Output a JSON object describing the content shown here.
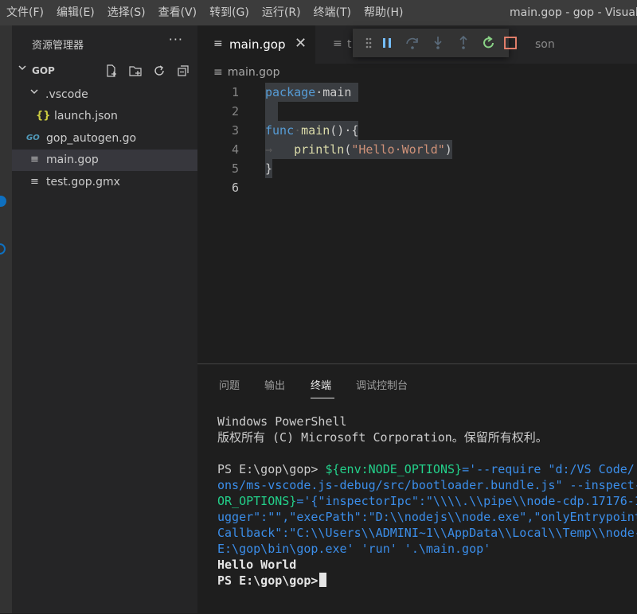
{
  "menu": [
    "文件(F)",
    "编辑(E)",
    "选择(S)",
    "查看(V)",
    "转到(G)",
    "运行(R)",
    "终端(T)",
    "帮助(H)"
  ],
  "window_title": "main.gop - gop - Visual",
  "sidebar": {
    "header": "资源管理器",
    "more": "···",
    "folder": "GOP",
    "items": [
      {
        "label": ".vscode",
        "icon": "chevron-down-icon",
        "glyph": "⌄"
      },
      {
        "label": "launch.json",
        "icon": "json-icon",
        "glyph": "{}"
      },
      {
        "label": "gop_autogen.go",
        "icon": "go-file-icon",
        "glyph": "GO"
      },
      {
        "label": "main.gop",
        "icon": "file-lines-icon",
        "glyph": "≡"
      },
      {
        "label": "test.gop.gmx",
        "icon": "file-lines-icon",
        "glyph": "≡"
      }
    ]
  },
  "tabs": {
    "active": "main.gop",
    "second": "t",
    "third_tail": "son"
  },
  "breadcrumb": "main.gop",
  "code": {
    "line_numbers": [
      "1",
      "2",
      "3",
      "4",
      "5",
      "6"
    ],
    "l1_kw": "package",
    "l1_rest": "·main",
    "l3_kw": "func",
    "l3_fn": "main",
    "l3_rest": "()·{",
    "l4_indent": "→   ",
    "l4_fn": "println",
    "l4_open": "(",
    "l4_str": "\"Hello·World\"",
    "l4_close": ")",
    "l5": "}"
  },
  "panel": {
    "tabs": [
      "问题",
      "输出",
      "终端",
      "调试控制台"
    ],
    "active_tab": "终端"
  },
  "terminal": {
    "l1": "Windows PowerShell",
    "l2": "版权所有 (C) Microsoft Corporation。保留所有权利。",
    "l3_prompt": "PS E:\\gop\\gop> ",
    "l3_var": "${env:NODE_OPTIONS}",
    "l3_rest": "='--require \"d:/VS Code/",
    "l4": "ons/ms-vscode.js-debug/src/bootloader.bundle.js\" --inspect-",
    "l5_a": "OR_OPTIONS}",
    "l5_b": "='{\"inspectorIpc\":\"\\\\\\\\.\\\\pipe\\\\node-cdp.17176-1",
    "l6": "ugger\":\"\",\"execPath\":\"D:\\\\nodejs\\\\node.exe\",\"onlyEntrypoint",
    "l7": "Callback\":\"C:\\\\Users\\\\ADMINI~1\\\\AppData\\\\Local\\\\Temp\\\\node-",
    "l8": "E:\\gop\\bin\\gop.exe' 'run' '.\\main.gop'",
    "l9": "Hello World",
    "l10": "PS E:\\gop\\gop>"
  },
  "colors": {
    "accent": "#0e70c0",
    "keyword": "#569cd6",
    "function": "#dcdcaa",
    "string": "#ce9178",
    "restart": "#89d185",
    "stop": "#f48771"
  }
}
